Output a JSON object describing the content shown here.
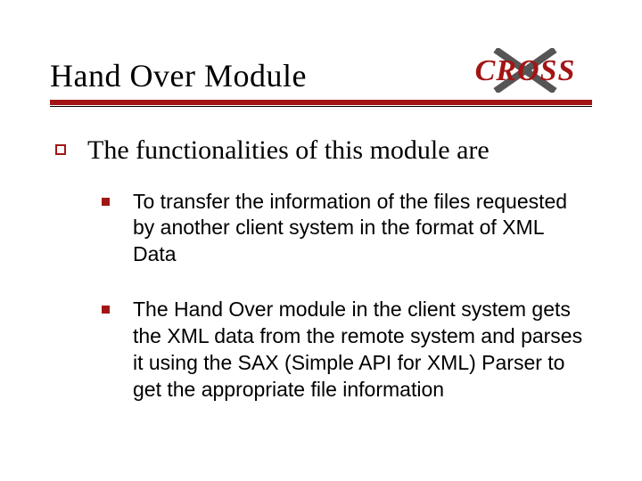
{
  "header": {
    "title": "Hand Over Module",
    "logo_text": "CROSS"
  },
  "content": {
    "main_point": "The functionalities of this module are",
    "sub_points": [
      "To transfer the information of the files requested by another client system in the format of XML Data",
      "The Hand Over module in the client system gets the XML data from the remote system and parses it using the SAX (Simple API for XML) Parser to get the appropriate file information"
    ]
  },
  "colors": {
    "accent": "#a31515"
  }
}
